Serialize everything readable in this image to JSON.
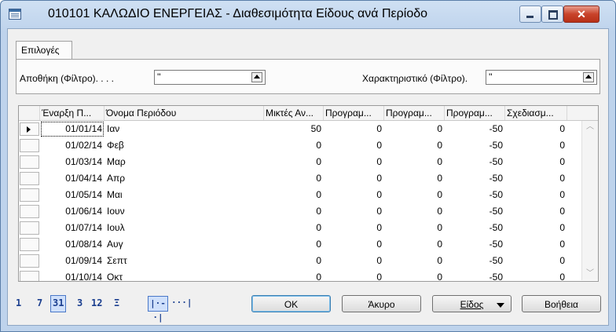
{
  "window": {
    "title": "010101 ΚΑΛΩΔΙΟ ΕΝΕΡΓΕΙΑΣ - Διαθεσιμότητα Είδους ανά Περίοδο"
  },
  "options_tab": {
    "label": "Επιλογές"
  },
  "filters": {
    "location_label": "Αποθήκη (Φίλτρο). . . .",
    "location_value": "''",
    "variant_label": "Χαρακτηριστικό (Φίλτρο).",
    "variant_value": "''"
  },
  "grid": {
    "columns": [
      "Έναρξη Π...",
      "Όνομα Περιόδου",
      "Μικτές Αν...",
      "Προγραμ...",
      "Προγραμ...",
      "Προγραμ...",
      "Σχεδιασμ..."
    ],
    "rows": [
      {
        "start": "01/01/14",
        "name": "Ιαν",
        "c1": "50",
        "c2": "0",
        "c3": "0",
        "c4": "-50",
        "c5": "0",
        "current": true
      },
      {
        "start": "01/02/14",
        "name": "Φεβ",
        "c1": "0",
        "c2": "0",
        "c3": "0",
        "c4": "-50",
        "c5": "0"
      },
      {
        "start": "01/03/14",
        "name": "Μαρ",
        "c1": "0",
        "c2": "0",
        "c3": "0",
        "c4": "-50",
        "c5": "0"
      },
      {
        "start": "01/04/14",
        "name": "Απρ",
        "c1": "0",
        "c2": "0",
        "c3": "0",
        "c4": "-50",
        "c5": "0"
      },
      {
        "start": "01/05/14",
        "name": "Μαι",
        "c1": "0",
        "c2": "0",
        "c3": "0",
        "c4": "-50",
        "c5": "0"
      },
      {
        "start": "01/06/14",
        "name": "Ιουν",
        "c1": "0",
        "c2": "0",
        "c3": "0",
        "c4": "-50",
        "c5": "0"
      },
      {
        "start": "01/07/14",
        "name": "Ιουλ",
        "c1": "0",
        "c2": "0",
        "c3": "0",
        "c4": "-50",
        "c5": "0"
      },
      {
        "start": "01/08/14",
        "name": "Αυγ",
        "c1": "0",
        "c2": "0",
        "c3": "0",
        "c4": "-50",
        "c5": "0"
      },
      {
        "start": "01/09/14",
        "name": "Σεπτ",
        "c1": "0",
        "c2": "0",
        "c3": "0",
        "c4": "-50",
        "c5": "0"
      },
      {
        "start": "01/10/14",
        "name": "Οκτ",
        "c1": "0",
        "c2": "0",
        "c3": "0",
        "c4": "-50",
        "c5": "0"
      }
    ]
  },
  "period_buttons": [
    "1",
    "7",
    "31",
    "3",
    "12",
    "Ξ"
  ],
  "period_selected": "31",
  "amount_type_icons": [
    "|·-·|",
    "···|"
  ],
  "buttons": {
    "ok": "OK",
    "cancel": "Άκυρο",
    "item": "Είδος",
    "help": "Βοήθεια"
  },
  "colors": {
    "accent": "#3c7fb1",
    "close_button": "#c8432b",
    "period_link": "#1a3e8f"
  }
}
